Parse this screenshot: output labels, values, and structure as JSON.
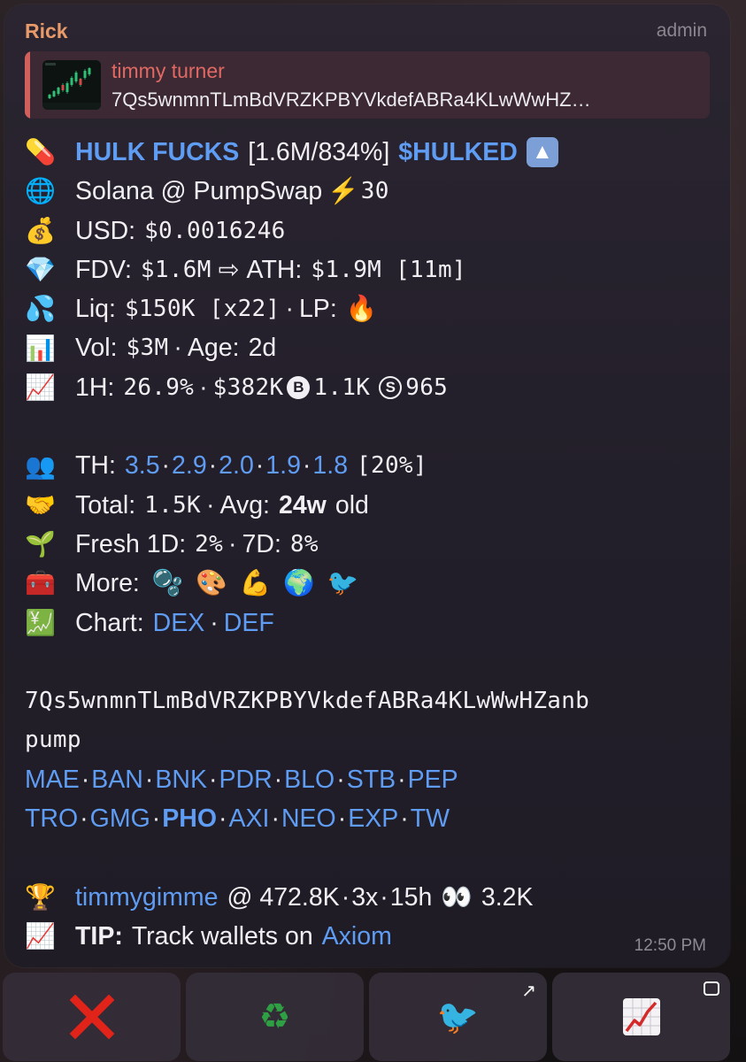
{
  "header": {
    "sender": "Rick",
    "role": "admin"
  },
  "reply": {
    "name": "timmy turner",
    "text": "7Qs5wnmnTLmBdVRZKPBYVkdefABRa4KLwWwHZ…"
  },
  "token": {
    "name": "HULK FUCKS",
    "stats": "[1.6M/834%]",
    "ticker": "$HULKED",
    "chain_line": "Solana @ PumpSwap",
    "chain_score": "30",
    "usd_label": "USD:",
    "usd_value": "$0.0016246",
    "fdv_label": "FDV:",
    "fdv_value": "$1.6M",
    "ath_label": "ATH:",
    "ath_value": "$1.9M [11m]",
    "liq_label": "Liq:",
    "liq_value": "$150K [x22]",
    "lp_label": "LP:",
    "vol_label": "Vol:",
    "vol_value": "$3M",
    "age_label": "Age:",
    "age_value": "2d",
    "h1_label": "1H:",
    "h1_value": "26.9%",
    "h1_usd": "$382K",
    "buys": "1.1K",
    "sells": "965"
  },
  "holders": {
    "th_label": "TH:",
    "th_values": [
      "3.5",
      "2.9",
      "2.0",
      "1.9",
      "1.8"
    ],
    "th_total": "[20%]",
    "total_label": "Total:",
    "total_value": "1.5K",
    "avg_label": "Avg:",
    "avg_value": "24w",
    "avg_suffix": "old",
    "fresh_label": "Fresh 1D:",
    "fresh_1d": "2%",
    "fresh_7d_label": "7D:",
    "fresh_7d": "8%",
    "more_label": "More:",
    "chart_label": "Chart:",
    "chart_links": [
      "DEX",
      "DEF"
    ]
  },
  "contract": {
    "line1": "7Qs5wnmnTLmBdVRZKPBYVkdefABRa4KLwWwHZanb",
    "line2": "pump"
  },
  "tags_row1": [
    "MAE",
    "BAN",
    "BNK",
    "PDR",
    "BLO",
    "STB",
    "PEP"
  ],
  "tags_row2": [
    "TRO",
    "GMG",
    "PHO",
    "AXI",
    "NEO",
    "EXP",
    "TW"
  ],
  "caller": {
    "name": "timmygimme",
    "at": "@ 472.8K",
    "mult": "3x",
    "age": "15h",
    "views": "3.2K"
  },
  "tip": {
    "label": "TIP:",
    "text": "Track wallets on",
    "link": "Axiom"
  },
  "timestamp": "12:50 PM",
  "buttons": [
    {
      "icon": "cross-mark-icon"
    },
    {
      "icon": "recycle-icon"
    },
    {
      "icon": "bird-icon"
    },
    {
      "icon": "chart-increasing-icon"
    }
  ],
  "colors": {
    "link": "#5f9cf3",
    "sender": "#e99a6a",
    "reply_name": "#e06a63"
  }
}
